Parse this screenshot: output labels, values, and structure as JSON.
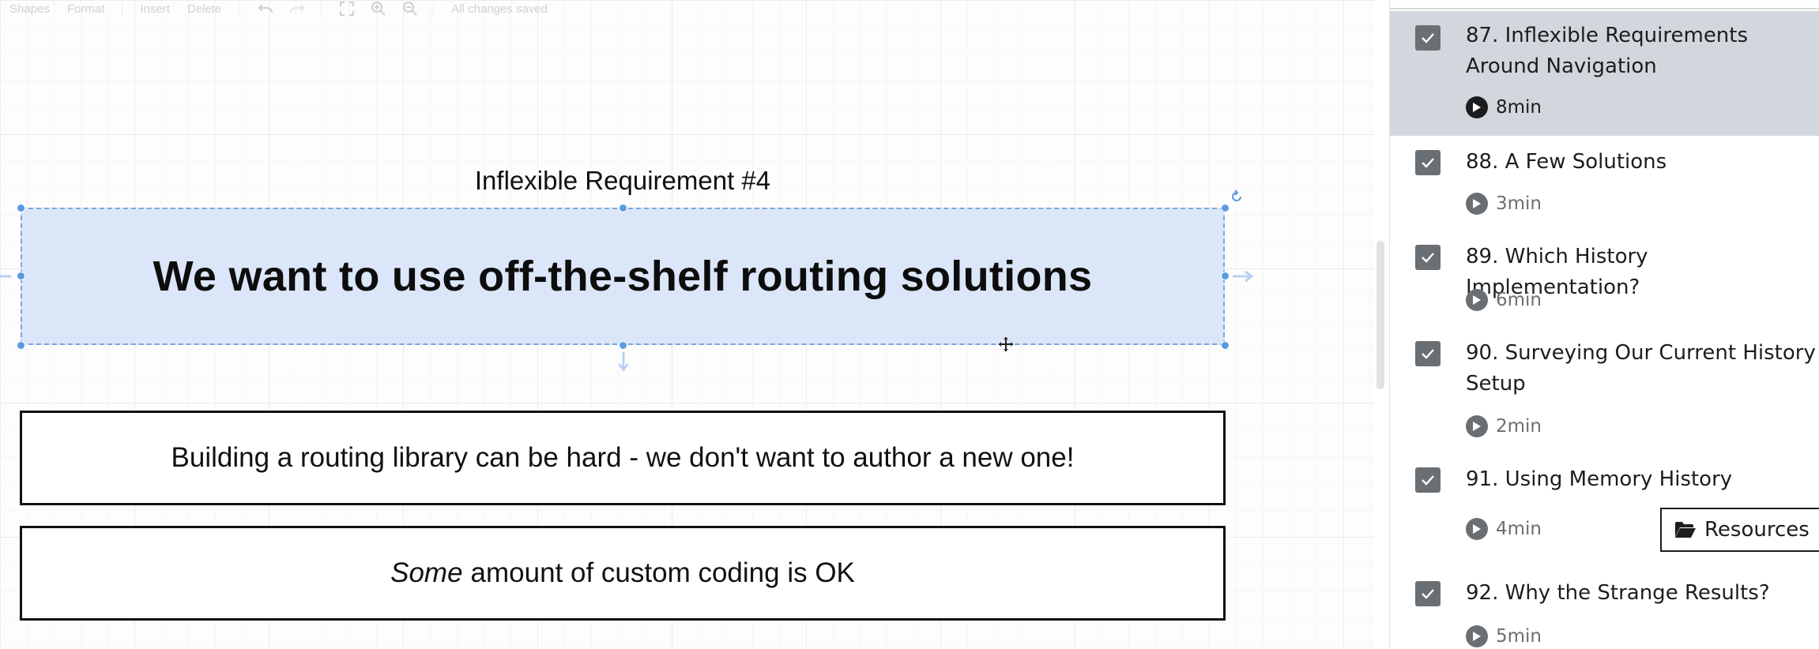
{
  "toolbar": {
    "shapes": "Shapes",
    "format": "Format",
    "insert": "Insert",
    "delete": "Delete",
    "status": "All changes saved",
    "icons": [
      "undo-icon",
      "redo-icon",
      "fullscreen-icon",
      "zoom-in-icon",
      "zoom-out-icon"
    ]
  },
  "diagram": {
    "title": "Inflexible Requirement #4",
    "main_text": "We want to use off-the-shelf routing solutions",
    "box1_text": "Building a routing library can be hard - we don't want to author a new one!",
    "box2_emphasis": "Some",
    "box2_text": "amount of custom coding is OK"
  },
  "colors": {
    "selection_fill": "#dbe6f8",
    "selection_border": "#7ba6db",
    "active_row": "#d1d7dc",
    "check_bg": "#6a6f73"
  },
  "sidebar": {
    "lectures": [
      {
        "title": "87. Inflexible Requirements Around Navigation",
        "duration": "8min",
        "completed": true,
        "active": true
      },
      {
        "title": "88. A Few Solutions",
        "duration": "3min",
        "completed": true,
        "active": false
      },
      {
        "title": "89. Which History Implementation?",
        "duration": "6min",
        "completed": true,
        "active": false
      },
      {
        "title": "90. Surveying Our Current History Setup",
        "duration": "2min",
        "completed": true,
        "active": false
      },
      {
        "title": "91. Using Memory History",
        "duration": "4min",
        "completed": true,
        "active": false
      },
      {
        "title": "92. Why the Strange Results?",
        "duration": "5min",
        "completed": true,
        "active": false
      }
    ],
    "resources_label": "Resources"
  }
}
